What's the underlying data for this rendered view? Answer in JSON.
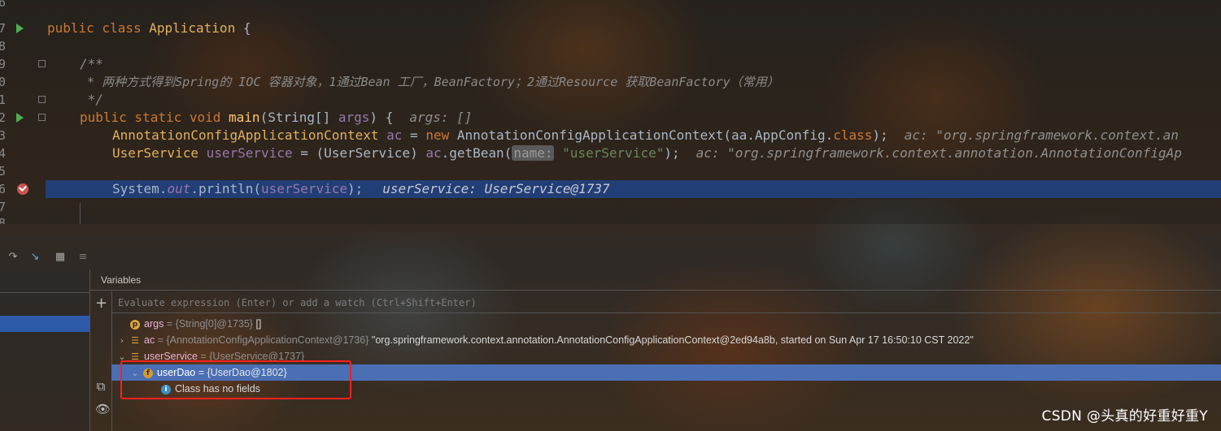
{
  "editor": {
    "lines": [
      {
        "num": "6"
      },
      {
        "num": "7",
        "p1": "public class ",
        "cls": "Application",
        "p2": " {"
      },
      {
        "num": "8"
      },
      {
        "num": "9",
        "text": "/**"
      },
      {
        "num": "0",
        "text": " * 两种方式得到Spring的 IOC 容器对象，1通过Bean 工厂，BeanFactory；2通过Resource 获取BeanFactory（常用）"
      },
      {
        "num": "1",
        "text": " */"
      },
      {
        "num": "2",
        "p1": "public static void ",
        "method": "main",
        "p2": "(String[] ",
        "param": "args",
        "p3": ") {",
        "inlay": "args: []"
      },
      {
        "num": "3",
        "cls": "AnnotationConfigApplicationContext",
        "sp": " ",
        "var": "ac",
        "p1": " = ",
        "kw": "new",
        "p2": " AnnotationConfigApplicationContext(aa.AppConfig.",
        "kw2": "class",
        "p3": ");",
        "inlay": "ac: \"org.springframework.context.an"
      },
      {
        "num": "4",
        "cls": "UserService",
        "sp": " ",
        "var": "userService",
        "p1": " = (UserService) ",
        "var2": "ac",
        "p2": ".getBean(",
        "hint": "name:",
        "str": " \"userService\"",
        "p3": ");",
        "inlay": "ac: \"org.springframework.context.annotation.AnnotationConfigAp"
      },
      {
        "num": "5"
      },
      {
        "num": "6",
        "p1": "System.",
        "field": "out",
        "p2": ".println(",
        "var": "userService",
        "p3": ");",
        "inlay": "userService: UserService@1737"
      },
      {
        "num": "7"
      },
      {
        "num": "8"
      }
    ]
  },
  "debug": {
    "variables_title": "Variables",
    "eval_placeholder": "Evaluate expression (Enter) or add a watch (Ctrl+Shift+Enter)",
    "rows": [
      {
        "name": "args",
        "ref": " = {String[0]@1735} ",
        "val": "[]"
      },
      {
        "name": "ac",
        "ref": " = {AnnotationConfigApplicationContext@1736} ",
        "val": "\"org.springframework.context.annotation.AnnotationConfigApplicationContext@2ed94a8b, started on Sun Apr 17 16:50:10 CST 2022\""
      },
      {
        "name": "userService",
        "ref": " = {UserService@1737}",
        "val": ""
      },
      {
        "name": "userDao",
        "ref": " = {UserDao@1802}",
        "val": ""
      },
      {
        "info": "Class has no fields"
      }
    ],
    "icons": {
      "toolbar": [
        "step-icon",
        "run-to-cursor-icon",
        "table-icon",
        "list-icon"
      ],
      "side": [
        "add-watch-icon",
        "copy-icon",
        "glasses-icon"
      ]
    }
  },
  "watermark": "CSDN @头真的好重好重Y",
  "colors": {
    "highlight": "#214283",
    "selected_row": "#4a6fb5",
    "red_box": "#ff2020",
    "breakpoint": "#c75450",
    "run": "#4caf50"
  }
}
